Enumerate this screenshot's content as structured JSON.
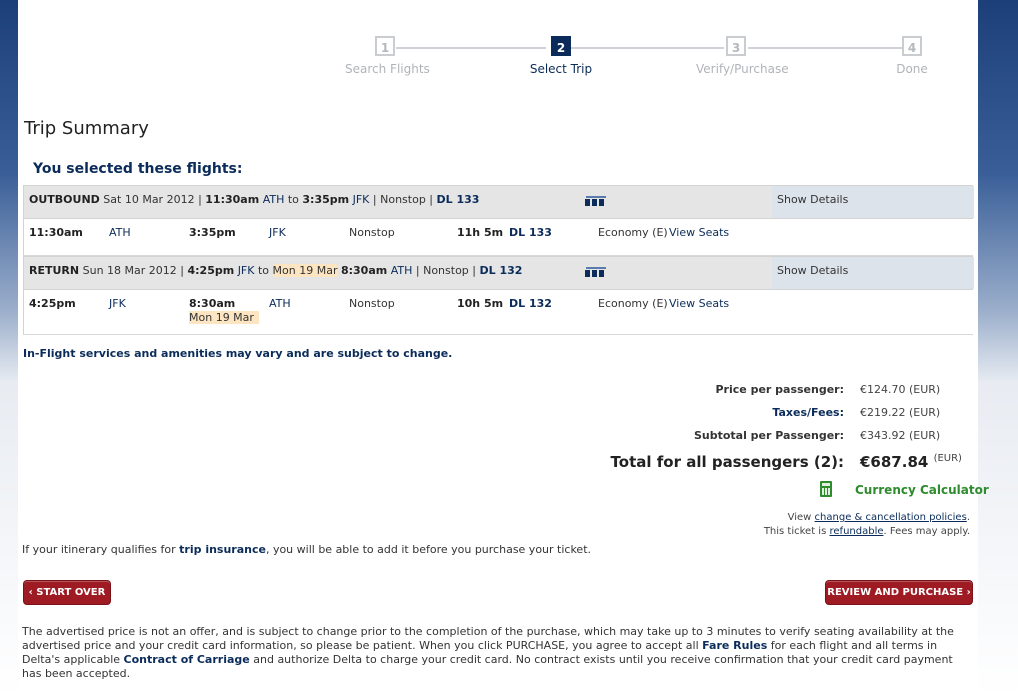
{
  "progress": {
    "steps": [
      {
        "num": "1",
        "label": "Search Flights"
      },
      {
        "num": "2",
        "label": "Select Trip"
      },
      {
        "num": "3",
        "label": "Verify/Purchase"
      },
      {
        "num": "4",
        "label": "Done"
      }
    ],
    "active_step": 2
  },
  "trip_summary": {
    "title": "Trip Summary",
    "selected_heading": "You selected these flights:"
  },
  "outbound": {
    "header": {
      "type": "OUTBOUND",
      "date": "Sat 10 Mar 2012",
      "sep1": " | ",
      "depart_time": "11:30am",
      "depart_code": "ATH",
      "to": "to",
      "arrive_time": "3:35pm",
      "arrive_code": "JFK",
      "sep2": " | ",
      "stops": "Nonstop",
      "sep3": " | ",
      "flight": "DL 133",
      "show_details": "Show Details"
    },
    "segment": {
      "depart_time": "11:30am",
      "depart_code": "ATH",
      "arrive_time": "3:35pm",
      "arrive_code": "JFK",
      "stops": "Nonstop",
      "duration": "11h 5m",
      "flight": "DL 133",
      "cabin": "Economy (E)",
      "view_seats": "View Seats"
    }
  },
  "return": {
    "header": {
      "type": "RETURN",
      "date": "Sun 18 Mar 2012",
      "sep1": " | ",
      "depart_time": "4:25pm",
      "depart_code": "JFK",
      "to": "to",
      "arrive_date": "Mon 19 Mar",
      "arrive_time": "8:30am",
      "arrive_code": "ATH",
      "sep2": " | ",
      "stops": "Nonstop",
      "sep3": " | ",
      "flight": "DL 132",
      "show_details": "Show Details"
    },
    "segment": {
      "depart_time": "4:25pm",
      "depart_code": "JFK",
      "arrive_time": "8:30am",
      "arrive_date": "Mon 19 Mar",
      "arrive_code": "ATH",
      "stops": "Nonstop",
      "duration": "10h 5m",
      "flight": "DL 132",
      "cabin": "Economy (E)",
      "view_seats": "View Seats"
    }
  },
  "amenity_note": "In-Flight services and amenities may vary and are subject to change.",
  "pricing": {
    "price_per_passenger_label": "Price per passenger:",
    "price_per_passenger": "€124.70 (EUR)",
    "taxes_label": "Taxes/Fees:",
    "taxes": "€219.22 (EUR)",
    "subtotal_label": "Subtotal per Passenger:",
    "subtotal": "€343.92 (EUR)",
    "total_label": "Total for all passengers (2):",
    "total": "€687.84",
    "total_currency": "(EUR)"
  },
  "currency_calculator": "Currency Calculator",
  "policy": {
    "view": "View",
    "change_link": "change & cancellation policies",
    "end": ".",
    "ticket_is": "This ticket is",
    "refundable": "refundable",
    "fees": ". Fees may apply."
  },
  "insurance": {
    "pre": "If your itinerary qualifies for",
    "link": "trip insurance",
    "post": ", you will be able to add it before you purchase your ticket."
  },
  "buttons": {
    "start_over": "START OVER",
    "review": "REVIEW AND PURCHASE"
  },
  "disclaimer": {
    "part1": "The advertised price is not an offer, and is subject to change prior to the completion of the purchase, which may take up to 3 minutes to verify seating availability at the advertised price and your credit card information, so please be patient. When you click PURCHASE, you agree to accept all",
    "fare_rules": "Fare Rules",
    "part2": "for each flight and all terms in Delta's applicable",
    "contract": "Contract of Carriage",
    "part3": "and authorize Delta to charge your credit card. No contract exists until you receive confirmation that your credit card payment has been accepted."
  },
  "icons": {
    "seat_map": "seat-map-icon",
    "calculator": "calculator-icon",
    "chevron_left": "chevron-left-icon",
    "chevron_right": "chevron-right-icon"
  },
  "colors": {
    "brand_navy": "#0b2c5a",
    "button_red": "#9e1b24",
    "highlight": "#fde5c2",
    "calculator_green": "#2e8b2e"
  }
}
